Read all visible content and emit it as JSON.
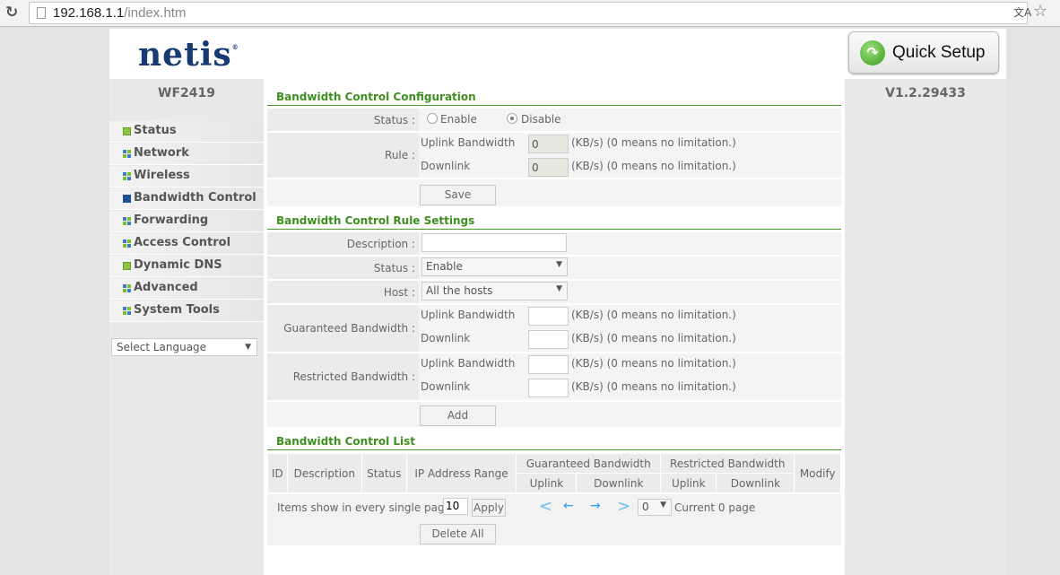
{
  "browser": {
    "url_host": "192.168.1.1",
    "url_path": "/index.htm"
  },
  "header": {
    "logo": "netis",
    "quick_setup": "Quick Setup"
  },
  "sidebar": {
    "model": "WF2419",
    "items": [
      {
        "label": "Status"
      },
      {
        "label": "Network"
      },
      {
        "label": "Wireless"
      },
      {
        "label": "Bandwidth Control"
      },
      {
        "label": "Forwarding"
      },
      {
        "label": "Access Control"
      },
      {
        "label": "Dynamic DNS"
      },
      {
        "label": "Advanced"
      },
      {
        "label": "System Tools"
      }
    ],
    "language": "Select Language"
  },
  "version": "V1.2.29433",
  "config": {
    "title": "Bandwidth Control Configuration",
    "status_label": "Status :",
    "enable": "Enable",
    "disable": "Disable",
    "selected": "Disable",
    "rule_label": "Rule :",
    "uplink": "Uplink Bandwidth",
    "downlink": "Downlink",
    "uplink_value": "0",
    "downlink_value": "0",
    "unit_note": "(KB/s) (0 means no limitation.)",
    "save": "Save"
  },
  "rule": {
    "title": "Bandwidth Control Rule Settings",
    "description_label": "Description :",
    "description_value": "",
    "status_label": "Status :",
    "status_value": "Enable",
    "host_label": "Host :",
    "host_value": "All the hosts",
    "guaranteed_label": "Guaranteed Bandwidth :",
    "restricted_label": "Restricted Bandwidth :",
    "uplink": "Uplink Bandwidth",
    "downlink": "Downlink",
    "unit_note": "(KB/s) (0 means no limitation.)",
    "add": "Add"
  },
  "list": {
    "title": "Bandwidth Control List",
    "headers": {
      "id": "ID",
      "description": "Description",
      "status": "Status",
      "ip_range": "IP Address Range",
      "guaranteed": "Guaranteed Bandwidth",
      "restricted": "Restricted Bandwidth",
      "modify": "Modify",
      "uplink": "Uplink",
      "downlink": "Downlink"
    },
    "items_label": "Items show in every single page",
    "items_value": "10",
    "apply": "Apply",
    "page_value": "0",
    "current_page": "Current 0 page",
    "delete_all": "Delete All"
  }
}
